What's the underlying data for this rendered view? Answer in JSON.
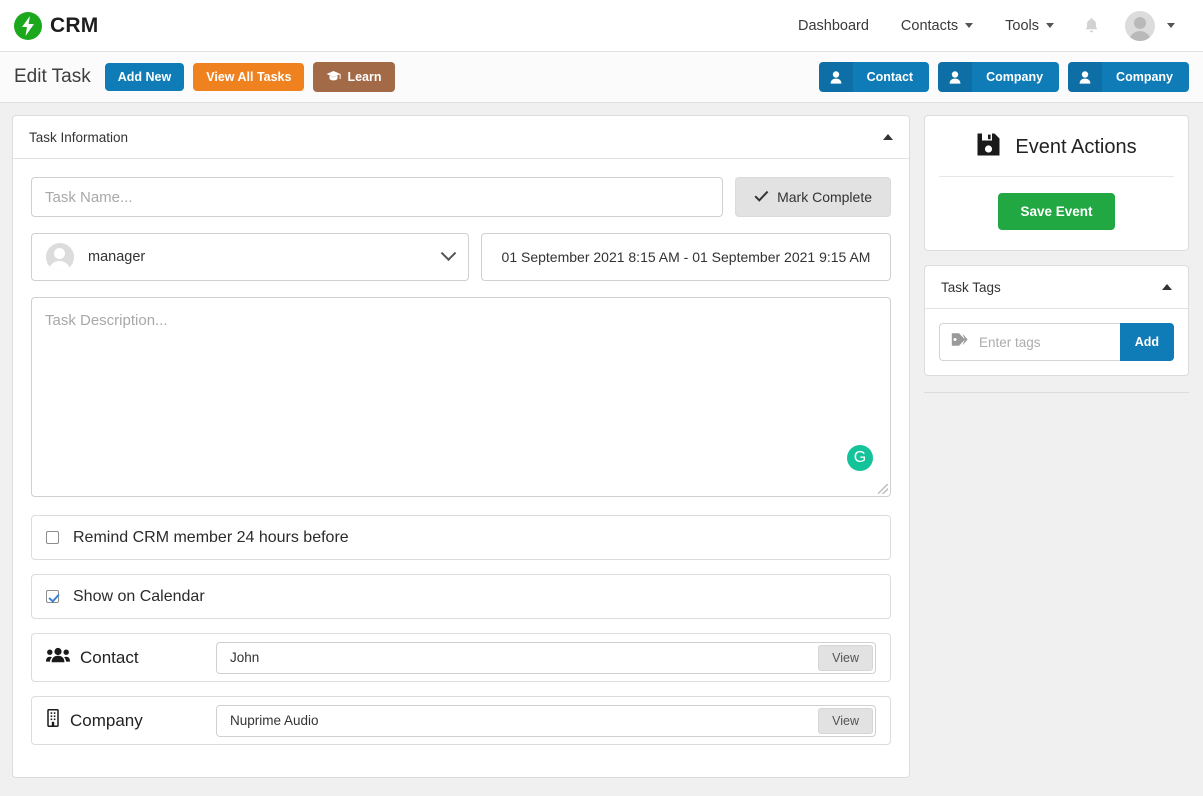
{
  "brand": {
    "name": "CRM",
    "logo_icon": "lightning-bolt-icon",
    "logo_color": "#1ca81c"
  },
  "topnav": {
    "items": [
      {
        "label": "Dashboard",
        "has_caret": false
      },
      {
        "label": "Contacts",
        "has_caret": true
      },
      {
        "label": "Tools",
        "has_caret": true
      }
    ],
    "bell_icon": "notification-bell-icon",
    "avatar_icon": "user-avatar-icon",
    "caret_icon": "chevron-down-icon"
  },
  "subheader": {
    "title": "Edit Task",
    "buttons": [
      {
        "label": "Add New",
        "color": "#0f7cb8",
        "icon": ""
      },
      {
        "label": "View All Tasks",
        "color": "#f0811f",
        "icon": ""
      },
      {
        "label": "Learn",
        "color": "#a26a47",
        "icon": "graduation-cap-icon"
      }
    ],
    "right_buttons": [
      {
        "label": "Contact",
        "icon": "person-icon",
        "color": "#0f7cb8"
      },
      {
        "label": "Company",
        "icon": "person-icon",
        "color": "#0f7cb8"
      },
      {
        "label": "Company",
        "icon": "person-icon",
        "color": "#0f7cb8"
      }
    ]
  },
  "task_information": {
    "panel_title": "Task Information",
    "collapse_icon": "caret-up-icon",
    "task_name": {
      "value": "",
      "placeholder": "Task Name..."
    },
    "mark_complete": {
      "label": "Mark Complete",
      "icon": "check-icon"
    },
    "assignee": {
      "value": "manager",
      "avatar_icon": "user-avatar-icon",
      "caret_icon": "chevron-down-icon"
    },
    "date_range": "01 September 2021 8:15 AM - 01 September 2021 9:15 AM",
    "description": {
      "value": "",
      "placeholder": "Task Description..."
    },
    "grammarly_badge": "G",
    "checkboxes": [
      {
        "label": "Remind CRM member 24 hours before",
        "checked": false
      },
      {
        "label": "Show on Calendar",
        "checked": true
      }
    ],
    "contact": {
      "label": "Contact",
      "icon": "users-group-icon",
      "value": "John",
      "button": "View"
    },
    "company": {
      "label": "Company",
      "icon": "building-icon",
      "value": "Nuprime Audio",
      "button": "View"
    }
  },
  "event_actions": {
    "title": "Event Actions",
    "icon": "floppy-save-icon",
    "save_label": "Save Event",
    "save_color": "#22a843"
  },
  "task_tags": {
    "title": "Task Tags",
    "collapse_icon": "caret-up-icon",
    "tag_icon": "tag-icon",
    "input_placeholder": "Enter tags",
    "input_value": "",
    "add_label": "Add",
    "add_color": "#0f7cb8"
  }
}
